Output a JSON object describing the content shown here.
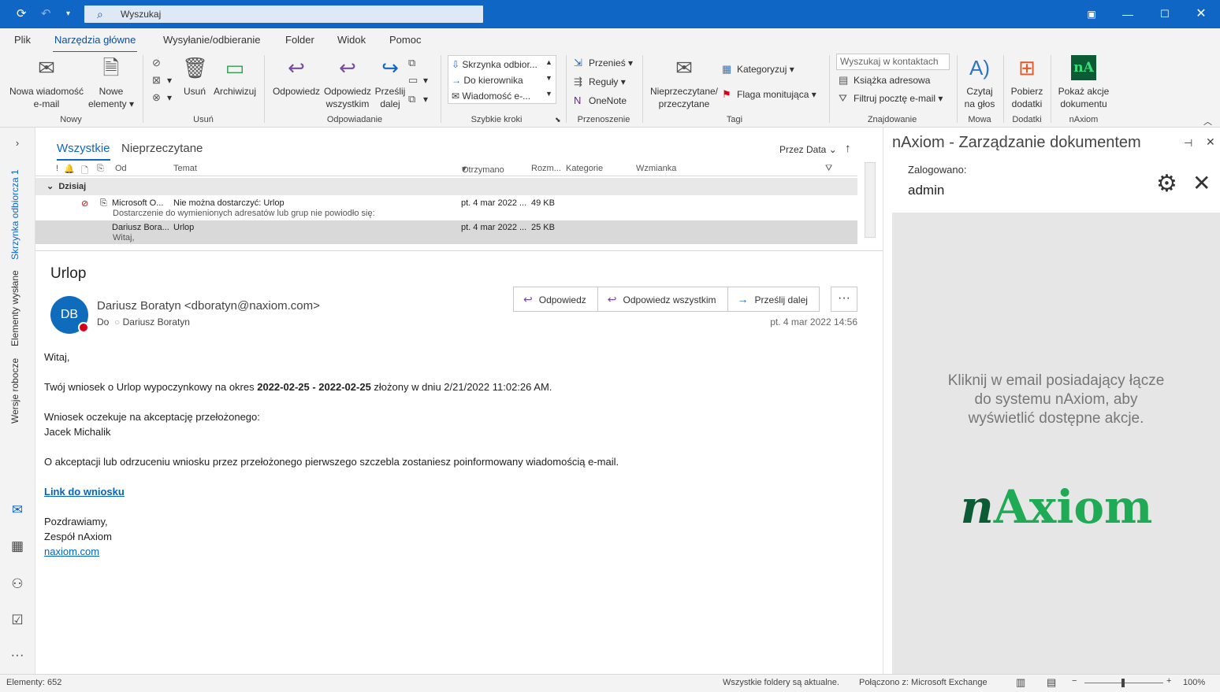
{
  "titlebar": {
    "search_placeholder": "Wyszukaj"
  },
  "menu": [
    "Plik",
    "Narzędzia główne",
    "Wysyłanie/odbieranie",
    "Folder",
    "Widok",
    "Pomoc"
  ],
  "ribbon": {
    "nowy": {
      "new_email": "Nowa wiadomość e-mail",
      "new_items": "Nowe elementy",
      "label": "Nowy"
    },
    "usun": {
      "delete": "Usuń",
      "archive": "Archiwizuj",
      "label": "Usuń"
    },
    "odp": {
      "reply": "Odpowiedz",
      "reply_all": "Odpowiedz wszystkim",
      "forward": "Prześlij dalej",
      "label": "Odpowiadanie"
    },
    "qs": {
      "items": [
        "Skrzynka odbior...",
        "Do kierownika",
        "Wiadomość e-..."
      ],
      "label": "Szybkie kroki"
    },
    "przen": {
      "move": "Przenieś",
      "rules": "Reguły",
      "onenote": "OneNote",
      "label": "Przenoszenie"
    },
    "tagi": {
      "unread": "Nieprzeczytane/ przeczytane",
      "categorize": "Kategoryzuj",
      "flag": "Flaga monitująca",
      "label": "Tagi"
    },
    "znajd": {
      "search_contacts": "Wyszukaj w kontaktach",
      "address_book": "Książka adresowa",
      "filter": "Filtruj pocztę e-mail",
      "label": "Znajdowanie"
    },
    "mowa": {
      "read_aloud": "Czytaj na głos",
      "label": "Mowa"
    },
    "dodatki": {
      "get_addins": "Pobierz dodatki",
      "label": "Dodatki"
    },
    "naxiom": {
      "show_actions": "Pokaż akcje dokumentu",
      "label": "nAxiom"
    }
  },
  "nav": {
    "inbox": "Skrzynka odbiorcza",
    "inbox_count": "1",
    "sent": "Elementy wysłane",
    "drafts": "Wersje robocze"
  },
  "list": {
    "tabs": [
      "Wszystkie",
      "Nieprzeczytane"
    ],
    "sort": "Przez Data",
    "columns": [
      "Od",
      "Temat",
      "Otrzymano",
      "Rozm...",
      "Kategorie",
      "Wzmianka"
    ],
    "group": "Dzisiaj",
    "rows": [
      {
        "from": "Microsoft O...",
        "subject": "Nie można dostarczyć: Urlop",
        "preview": "Dostarczenie do wymienionych adresatów lub grup nie powiodło się:",
        "date": "pt. 4 mar 2022 ...",
        "size": "49 KB"
      },
      {
        "from": "Dariusz Bora...",
        "subject": "Urlop",
        "preview": "Witaj,",
        "date": "pt. 4 mar 2022 ...",
        "size": "25 KB"
      }
    ]
  },
  "email": {
    "subject": "Urlop",
    "initials": "DB",
    "sender": "Dariusz Boratyn <dboratyn@naxiom.com>",
    "to_label": "Do",
    "to": "Dariusz Boratyn",
    "date": "pt. 4 mar 2022 14:56",
    "actions": {
      "reply": "Odpowiedz",
      "reply_all": "Odpowiedz wszystkim",
      "forward": "Prześlij dalej"
    },
    "greeting": "Witaj,",
    "line1_pre": "Twój wniosek o Urlop wypoczynkowy na okres ",
    "line1_from": "2022-02-25",
    "line1_dash": " - ",
    "line1_to": "2022-02-25",
    "line1_post": " złożony w dniu 2/21/2022 11:02:26 AM.",
    "line2": "Wniosek oczekuje na akceptację przełożonego:",
    "approver": "Jacek Michalik",
    "line3": "O akceptacji lub odrzuceniu wniosku przez przełożonego pierwszego szczebla zostaniesz poinformowany wiadomością e-mail.",
    "link": "Link do wniosku",
    "closing": "Pozdrawiamy,",
    "team": "Zespół nAxiom",
    "site": "naxiom.com"
  },
  "naxiom": {
    "title": "nAxiom - Zarządzanie dokumentem",
    "logged_label": "Zalogowano:",
    "user": "admin",
    "message": "Kliknij w email posiadający łącze do systemu nAxiom, aby wyświetlić dostępne akcje.",
    "logo": "nAxiom"
  },
  "status": {
    "items": "Elementy: 652",
    "folders": "Wszystkie foldery są aktualne.",
    "connected": "Połączono z: Microsoft Exchange",
    "zoom": "100%"
  }
}
